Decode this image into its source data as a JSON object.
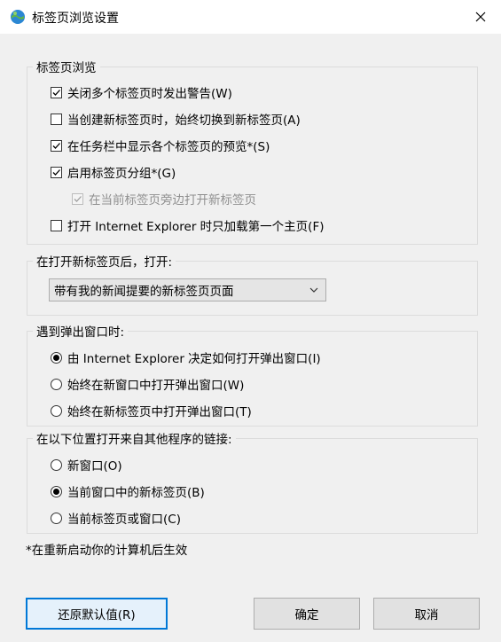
{
  "window": {
    "title": "标签页浏览设置"
  },
  "groups": {
    "tab_browsing": {
      "legend": "标签页浏览",
      "options": [
        {
          "label": "关闭多个标签页时发出警告(W)",
          "checked": true,
          "disabled": false
        },
        {
          "label": "当创建新标签页时，始终切换到新标签页(A)",
          "checked": false,
          "disabled": false
        },
        {
          "label": "在任务栏中显示各个标签页的预览*(S)",
          "checked": true,
          "disabled": false
        },
        {
          "label": "启用标签页分组*(G)",
          "checked": true,
          "disabled": false
        },
        {
          "label": "在当前标签页旁边打开新标签页",
          "checked": true,
          "disabled": true
        },
        {
          "label": "打开 Internet Explorer 时只加载第一个主页(F)",
          "checked": false,
          "disabled": false
        }
      ]
    },
    "new_tab": {
      "legend": "在打开新标签页后，打开:",
      "selected": "带有我的新闻提要的新标签页页面"
    },
    "popups": {
      "legend": "遇到弹出窗口时:",
      "options": [
        {
          "label": "由 Internet Explorer 决定如何打开弹出窗口(I)",
          "selected": true
        },
        {
          "label": "始终在新窗口中打开弹出窗口(W)",
          "selected": false
        },
        {
          "label": "始终在新标签页中打开弹出窗口(T)",
          "selected": false
        }
      ]
    },
    "external_links": {
      "legend": "在以下位置打开来自其他程序的链接:",
      "options": [
        {
          "label": "新窗口(O)",
          "selected": false
        },
        {
          "label": "当前窗口中的新标签页(B)",
          "selected": true
        },
        {
          "label": "当前标签页或窗口(C)",
          "selected": false
        }
      ]
    }
  },
  "note": "*在重新启动你的计算机后生效",
  "buttons": {
    "restore_defaults": "还原默认值(R)",
    "ok": "确定",
    "cancel": "取消"
  },
  "colors": {
    "focus_border": "#0078d7",
    "background": "#f0f0f0"
  }
}
